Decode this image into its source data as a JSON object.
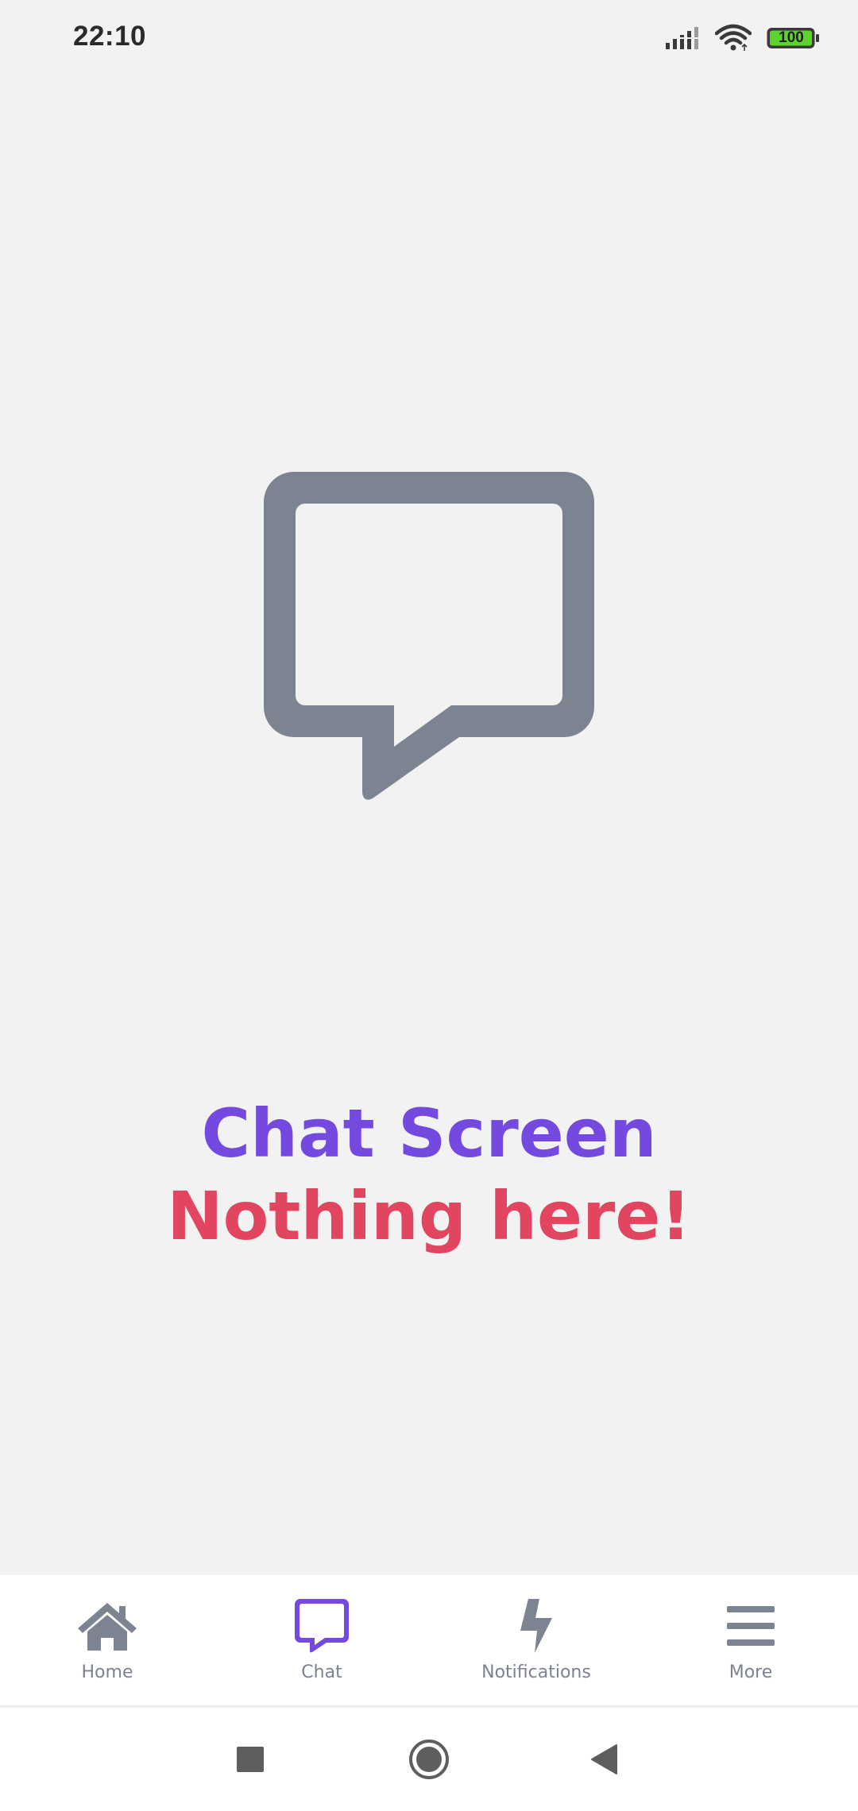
{
  "status_bar": {
    "time": "22:10",
    "battery_level": "100",
    "icons": [
      "signal-icon",
      "wifi-icon",
      "battery-icon"
    ]
  },
  "screen": {
    "illustration_icon": "chat-bubble-icon",
    "title": "Chat Screen",
    "subtitle": "Nothing here!"
  },
  "bottom_nav": {
    "items": [
      {
        "label": "Home",
        "icon": "home-icon",
        "active": false
      },
      {
        "label": "Chat",
        "icon": "chat-icon",
        "active": true
      },
      {
        "label": "Notifications",
        "icon": "lightning-icon",
        "active": false
      },
      {
        "label": "More",
        "icon": "menu-icon",
        "active": false
      }
    ]
  },
  "system_nav": {
    "buttons": [
      "recents-button",
      "home-button",
      "back-button"
    ]
  },
  "colors": {
    "background": "#F2F2F3",
    "icon_gray": "#7C8391",
    "accent_purple": "#7449E0",
    "accent_red": "#E2455F",
    "battery_green": "#5BD42E"
  }
}
